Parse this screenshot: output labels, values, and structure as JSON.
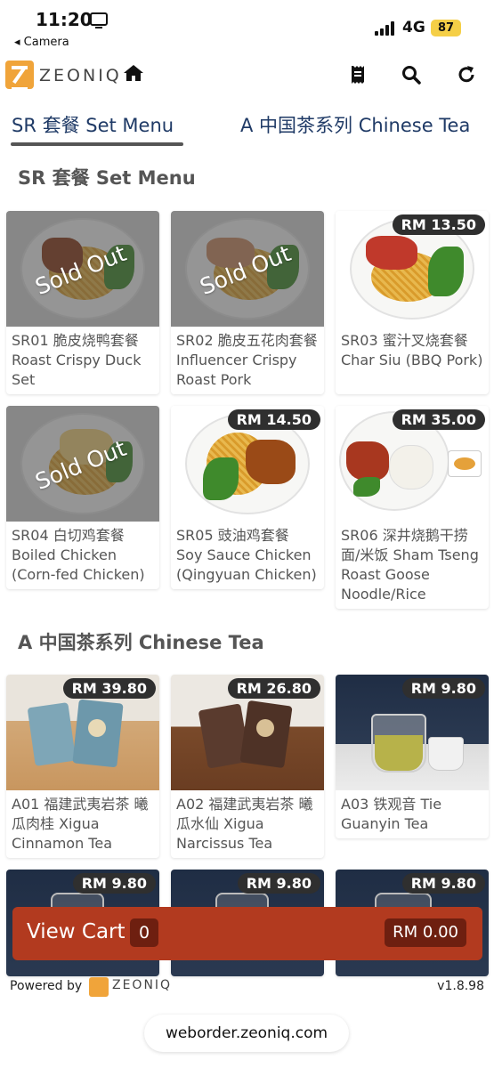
{
  "status_bar": {
    "time": "11:20",
    "back_label": "◂ Camera",
    "network": "4G",
    "battery": "87"
  },
  "header": {
    "logo_text": "ZEONIQ"
  },
  "tabs": [
    {
      "label": "SR 套餐 Set Menu",
      "active": true
    },
    {
      "label": "A 中国茶系列 Chinese Tea",
      "active": false
    }
  ],
  "sections": [
    {
      "title": "SR 套餐 Set Menu",
      "items": [
        {
          "name": "SR01 脆皮烧鸭套餐 Roast Crispy Duck Set",
          "price": "",
          "sold_out": "Sold Out"
        },
        {
          "name": "SR02 脆皮五花肉套餐 Influencer Crispy Roast Pork",
          "price": "",
          "sold_out": "Sold Out"
        },
        {
          "name": "SR03 蜜汁叉烧套餐 Char Siu (BBQ Pork)",
          "price": "RM 13.50",
          "sold_out": ""
        },
        {
          "name": "SR04 白切鸡套餐 Boiled Chicken (Corn-fed Chicken)",
          "price": "",
          "sold_out": "Sold Out"
        },
        {
          "name": "SR05 豉油鸡套餐 Soy Sauce Chicken (Qingyuan Chicken)",
          "price": "RM 14.50",
          "sold_out": ""
        },
        {
          "name": "SR06 深井烧鹅干捞面/米饭 Sham Tseng Roast Goose Noodle/Rice",
          "price": "RM 35.00",
          "sold_out": ""
        }
      ]
    },
    {
      "title": "A 中国茶系列 Chinese Tea",
      "items": [
        {
          "name": "A01 福建武夷岩茶 曦瓜肉桂 Xigua Cinnamon Tea",
          "price": "RM 39.80"
        },
        {
          "name": "A02 福建武夷岩茶 曦瓜水仙 Xigua Narcissus Tea",
          "price": "RM 26.80"
        },
        {
          "name": "A03 铁观音 Tie Guanyin Tea",
          "price": "RM 9.80"
        },
        {
          "name": "",
          "price": "RM 9.80"
        },
        {
          "name": "",
          "price": "RM 9.80"
        },
        {
          "name": "",
          "price": "RM 9.80"
        }
      ]
    }
  ],
  "cart": {
    "label": "View Cart",
    "count": "0",
    "total": "RM 0.00"
  },
  "footer": {
    "powered_by": "Powered by",
    "logo_text": "ZEONIQ",
    "version": "v1.8.98"
  },
  "browser": {
    "url": "weborder.zeoniq.com"
  },
  "colors": {
    "accent": "#b23a1f",
    "tab_text": "#1f3a66",
    "logo": "#f0a43a"
  }
}
